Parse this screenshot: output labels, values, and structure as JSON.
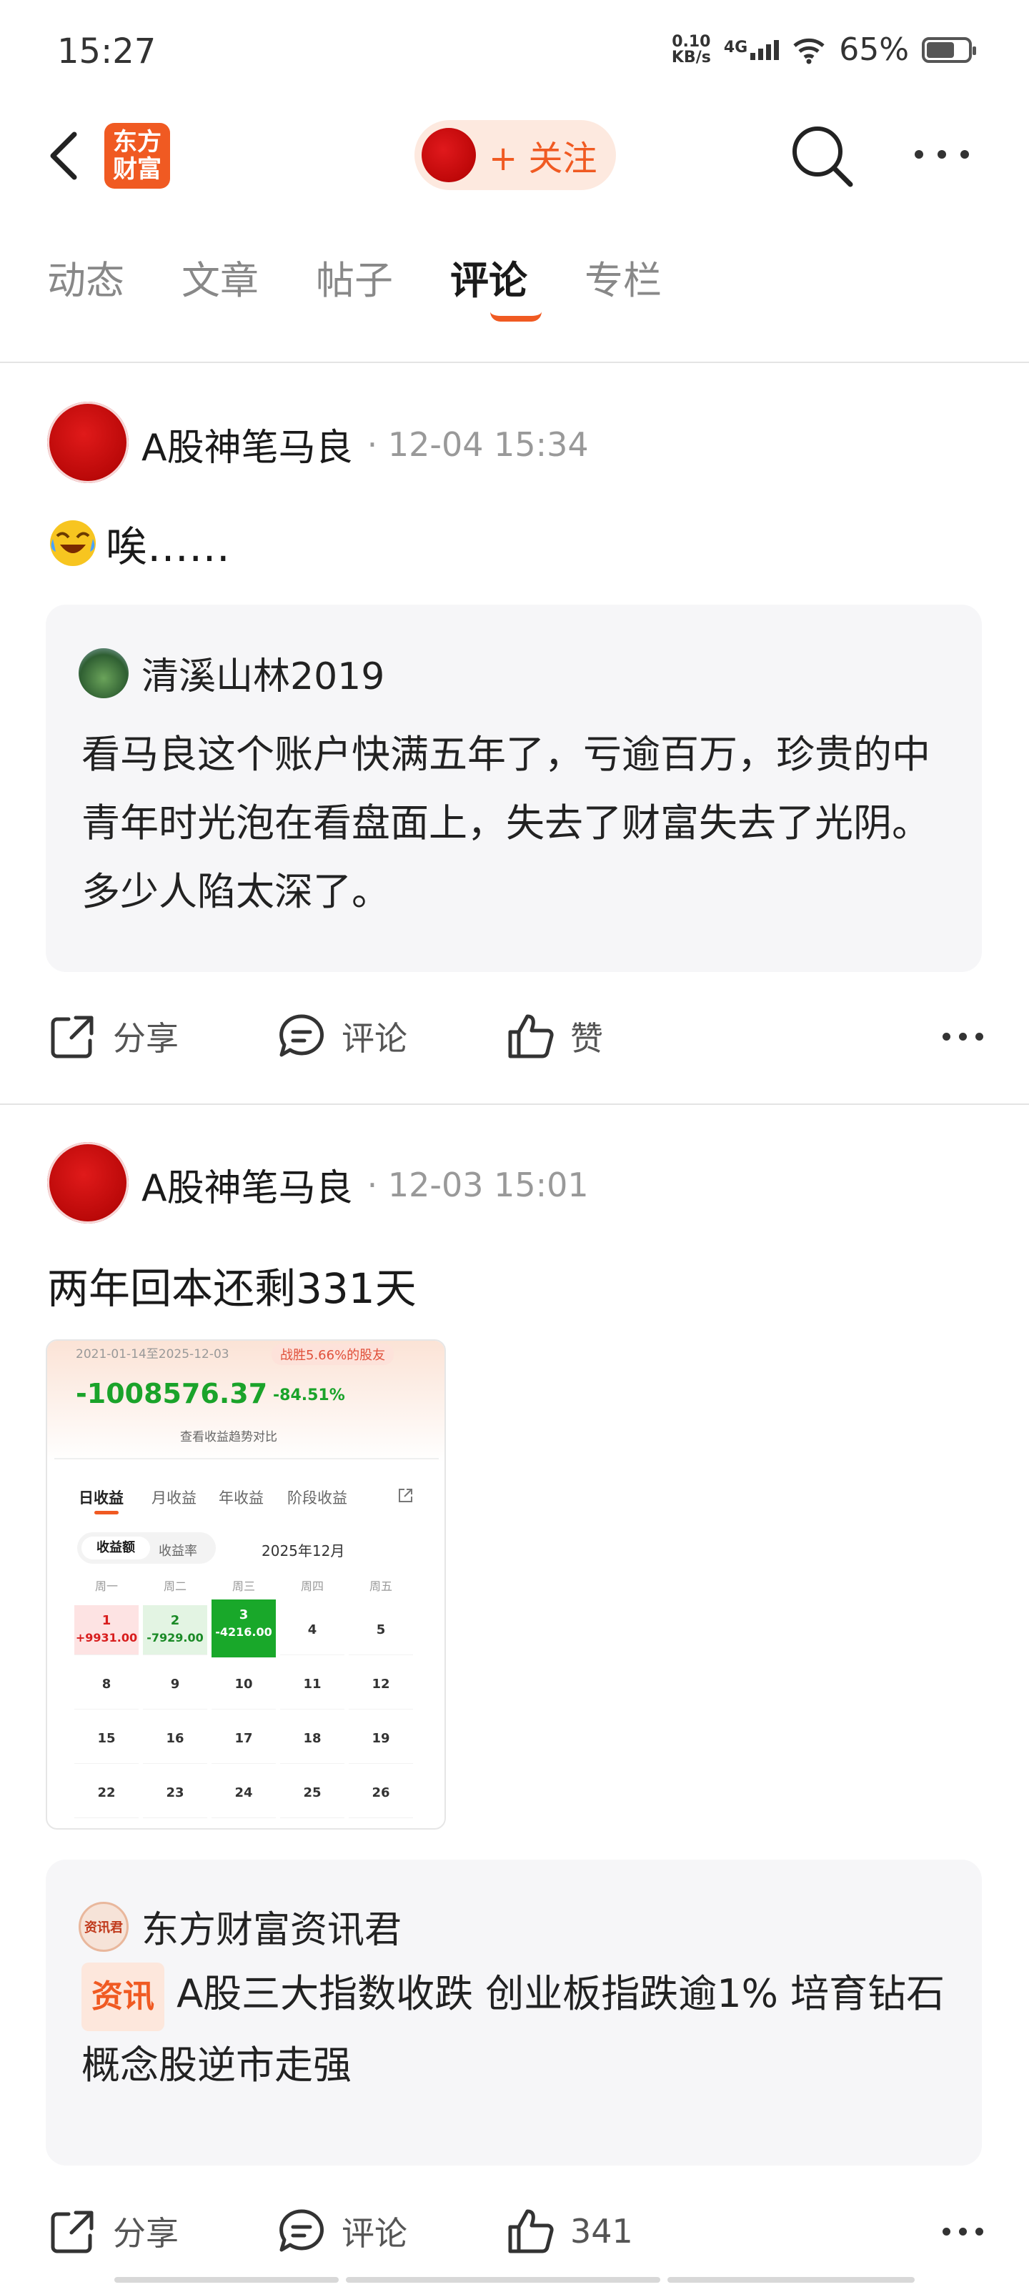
{
  "status_bar": {
    "time": "15:27",
    "net_speed": "0.10",
    "net_unit": "KB/s",
    "network": "4G",
    "battery": "65%"
  },
  "nav": {
    "logo_line1": "东方",
    "logo_line2": "财富",
    "follow_label": "+ 关注"
  },
  "tabs": [
    {
      "label": "动态"
    },
    {
      "label": "文章"
    },
    {
      "label": "帖子"
    },
    {
      "label": "评论",
      "active": true
    },
    {
      "label": "专栏"
    }
  ],
  "posts": [
    {
      "author": "A股神笔马良",
      "time": "· 12-04 15:34",
      "text": "唉……",
      "quote": {
        "user": "清溪山林2019",
        "body": "看马良这个账户快满五年了，亏逾百万，珍贵的中青年时光泡在看盘面上，失去了财富失去了光阴。多少人陷太深了。"
      },
      "actions": {
        "share": "分享",
        "comment": "评论",
        "like": "赞"
      }
    },
    {
      "author": "A股神笔马良",
      "time": "· 12-03 15:01",
      "text": "两年回本还剩331天",
      "image": {
        "date_range": "2021-01-14至2025-12-03",
        "badge": "战胜5.66%的股友",
        "total": "-1008576.37",
        "percent": "-84.51%",
        "compare": "查看收益趋势对比",
        "tabs": [
          "日收益",
          "月收益",
          "年收益",
          "阶段收益"
        ],
        "toggle": [
          "收益额",
          "收益率"
        ],
        "month": "2025年12月",
        "weekdays": [
          "周一",
          "周二",
          "周三",
          "周四",
          "周五"
        ],
        "days": [
          {
            "day": "1",
            "val": "+9931.00"
          },
          {
            "day": "2",
            "val": "-7929.00"
          },
          {
            "day": "3",
            "val": "-4216.00"
          },
          {
            "day": "4"
          },
          {
            "day": "5"
          },
          {
            "day": "8"
          },
          {
            "day": "9"
          },
          {
            "day": "10"
          },
          {
            "day": "11"
          },
          {
            "day": "12"
          },
          {
            "day": "15"
          },
          {
            "day": "16"
          },
          {
            "day": "17"
          },
          {
            "day": "18"
          },
          {
            "day": "19"
          },
          {
            "day": "22"
          },
          {
            "day": "23"
          },
          {
            "day": "24"
          },
          {
            "day": "25"
          },
          {
            "day": "26"
          }
        ]
      },
      "quote": {
        "user": "东方财富资讯君",
        "tag": "资讯",
        "body": "A股三大指数收跌 创业板指跌逾1% 培育钻石概念股逆市走强"
      },
      "actions": {
        "share": "分享",
        "comment": "评论",
        "like": "341"
      }
    }
  ],
  "colors": {
    "accent": "#f05a22",
    "red": "#e01a1a",
    "green": "#1aa32a"
  }
}
